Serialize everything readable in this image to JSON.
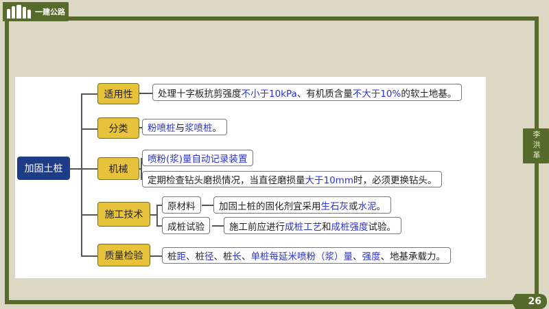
{
  "header": {
    "tag_label": "一建公路"
  },
  "side_tag": {
    "label": "李洪革"
  },
  "page_number": "26",
  "mindmap": {
    "root": "加固土桩",
    "branches": [
      {
        "label": "适用性",
        "leaves": [
          [
            {
              "t": "处理十字板抗剪强度"
            },
            {
              "t": "不小于10kPa",
              "hl": true
            },
            {
              "t": "、有机质含量"
            },
            {
              "t": "不大于10%",
              "hl": true
            },
            {
              "t": "的软土地基。"
            }
          ]
        ]
      },
      {
        "label": "分类",
        "leaves": [
          [
            {
              "t": "粉喷桩",
              "hl": true
            },
            {
              "t": "与"
            },
            {
              "t": "浆喷桩",
              "hl": true
            },
            {
              "t": "。"
            }
          ]
        ]
      },
      {
        "label": "机械",
        "leaves": [
          [
            {
              "t": "喷粉(浆)量自动记录装置",
              "hl": true
            }
          ],
          [
            {
              "t": "定期检查钻头磨损情况，当直径磨损量"
            },
            {
              "t": "大于10mm",
              "hl": true
            },
            {
              "t": "时，必须更换钻头。"
            }
          ]
        ]
      },
      {
        "label": "施工技术",
        "subs": [
          {
            "label": "原材料",
            "leaf": [
              {
                "t": "加固土桩的固化剂宜采用"
              },
              {
                "t": "生石灰",
                "hl": true
              },
              {
                "t": "或"
              },
              {
                "t": "水泥",
                "hl": true
              },
              {
                "t": "。"
              }
            ]
          },
          {
            "label": "成桩试验",
            "leaf": [
              {
                "t": "施工前应进行"
              },
              {
                "t": "成桩工艺",
                "hl": true
              },
              {
                "t": "和"
              },
              {
                "t": "成桩强度",
                "hl": true
              },
              {
                "t": "试验。"
              }
            ]
          }
        ]
      },
      {
        "label": "质量检验",
        "leaves": [
          [
            {
              "t": "桩"
            },
            {
              "t": "距",
              "hl": true
            },
            {
              "t": "、桩"
            },
            {
              "t": "径",
              "hl": true
            },
            {
              "t": "、桩"
            },
            {
              "t": "长",
              "hl": true
            },
            {
              "t": "、"
            },
            {
              "t": "单桩每延米喷粉（浆）量",
              "hl": true
            },
            {
              "t": "、"
            },
            {
              "t": "强度",
              "hl": true
            },
            {
              "t": "、地基承载力。"
            }
          ]
        ]
      }
    ]
  }
}
